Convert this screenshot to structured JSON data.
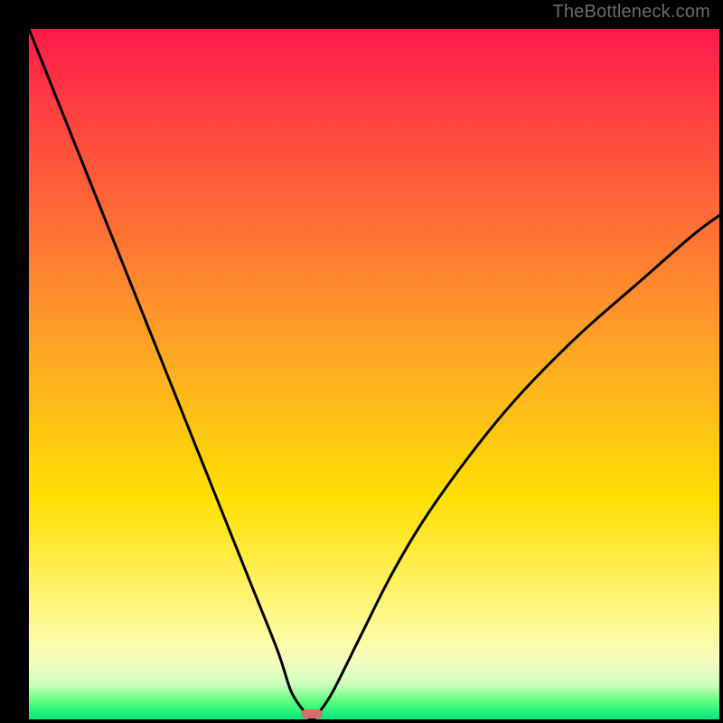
{
  "watermark": "TheBottleneck.com",
  "chart_data": {
    "type": "line",
    "title": "",
    "xlabel": "",
    "ylabel": "",
    "xlim": [
      0,
      100
    ],
    "ylim": [
      0,
      100
    ],
    "grid": false,
    "legend": false,
    "background_gradient": {
      "direction": "vertical",
      "stops": [
        {
          "pos": 0,
          "color": "#ff1a4b"
        },
        {
          "pos": 0.32,
          "color": "#ff7a33"
        },
        {
          "pos": 0.68,
          "color": "#ffe000"
        },
        {
          "pos": 0.92,
          "color": "#f2fcc0"
        },
        {
          "pos": 1.0,
          "color": "#00e87a"
        }
      ]
    },
    "series": [
      {
        "name": "bottleneck-curve",
        "x": [
          0,
          4,
          8,
          12,
          16,
          20,
          24,
          28,
          32,
          36,
          38,
          40,
          41,
          42,
          44,
          48,
          52,
          56,
          60,
          66,
          72,
          80,
          88,
          96,
          100
        ],
        "y": [
          100,
          90,
          80,
          70,
          60,
          50,
          40,
          30,
          20,
          10,
          4,
          1,
          0,
          1,
          4,
          12,
          20,
          27,
          33,
          41,
          48,
          56,
          63,
          70,
          73
        ],
        "color": "#000000"
      }
    ],
    "marker": {
      "name": "current-config-marker",
      "x": 41,
      "y": 0,
      "color": "#d96d6d"
    }
  }
}
